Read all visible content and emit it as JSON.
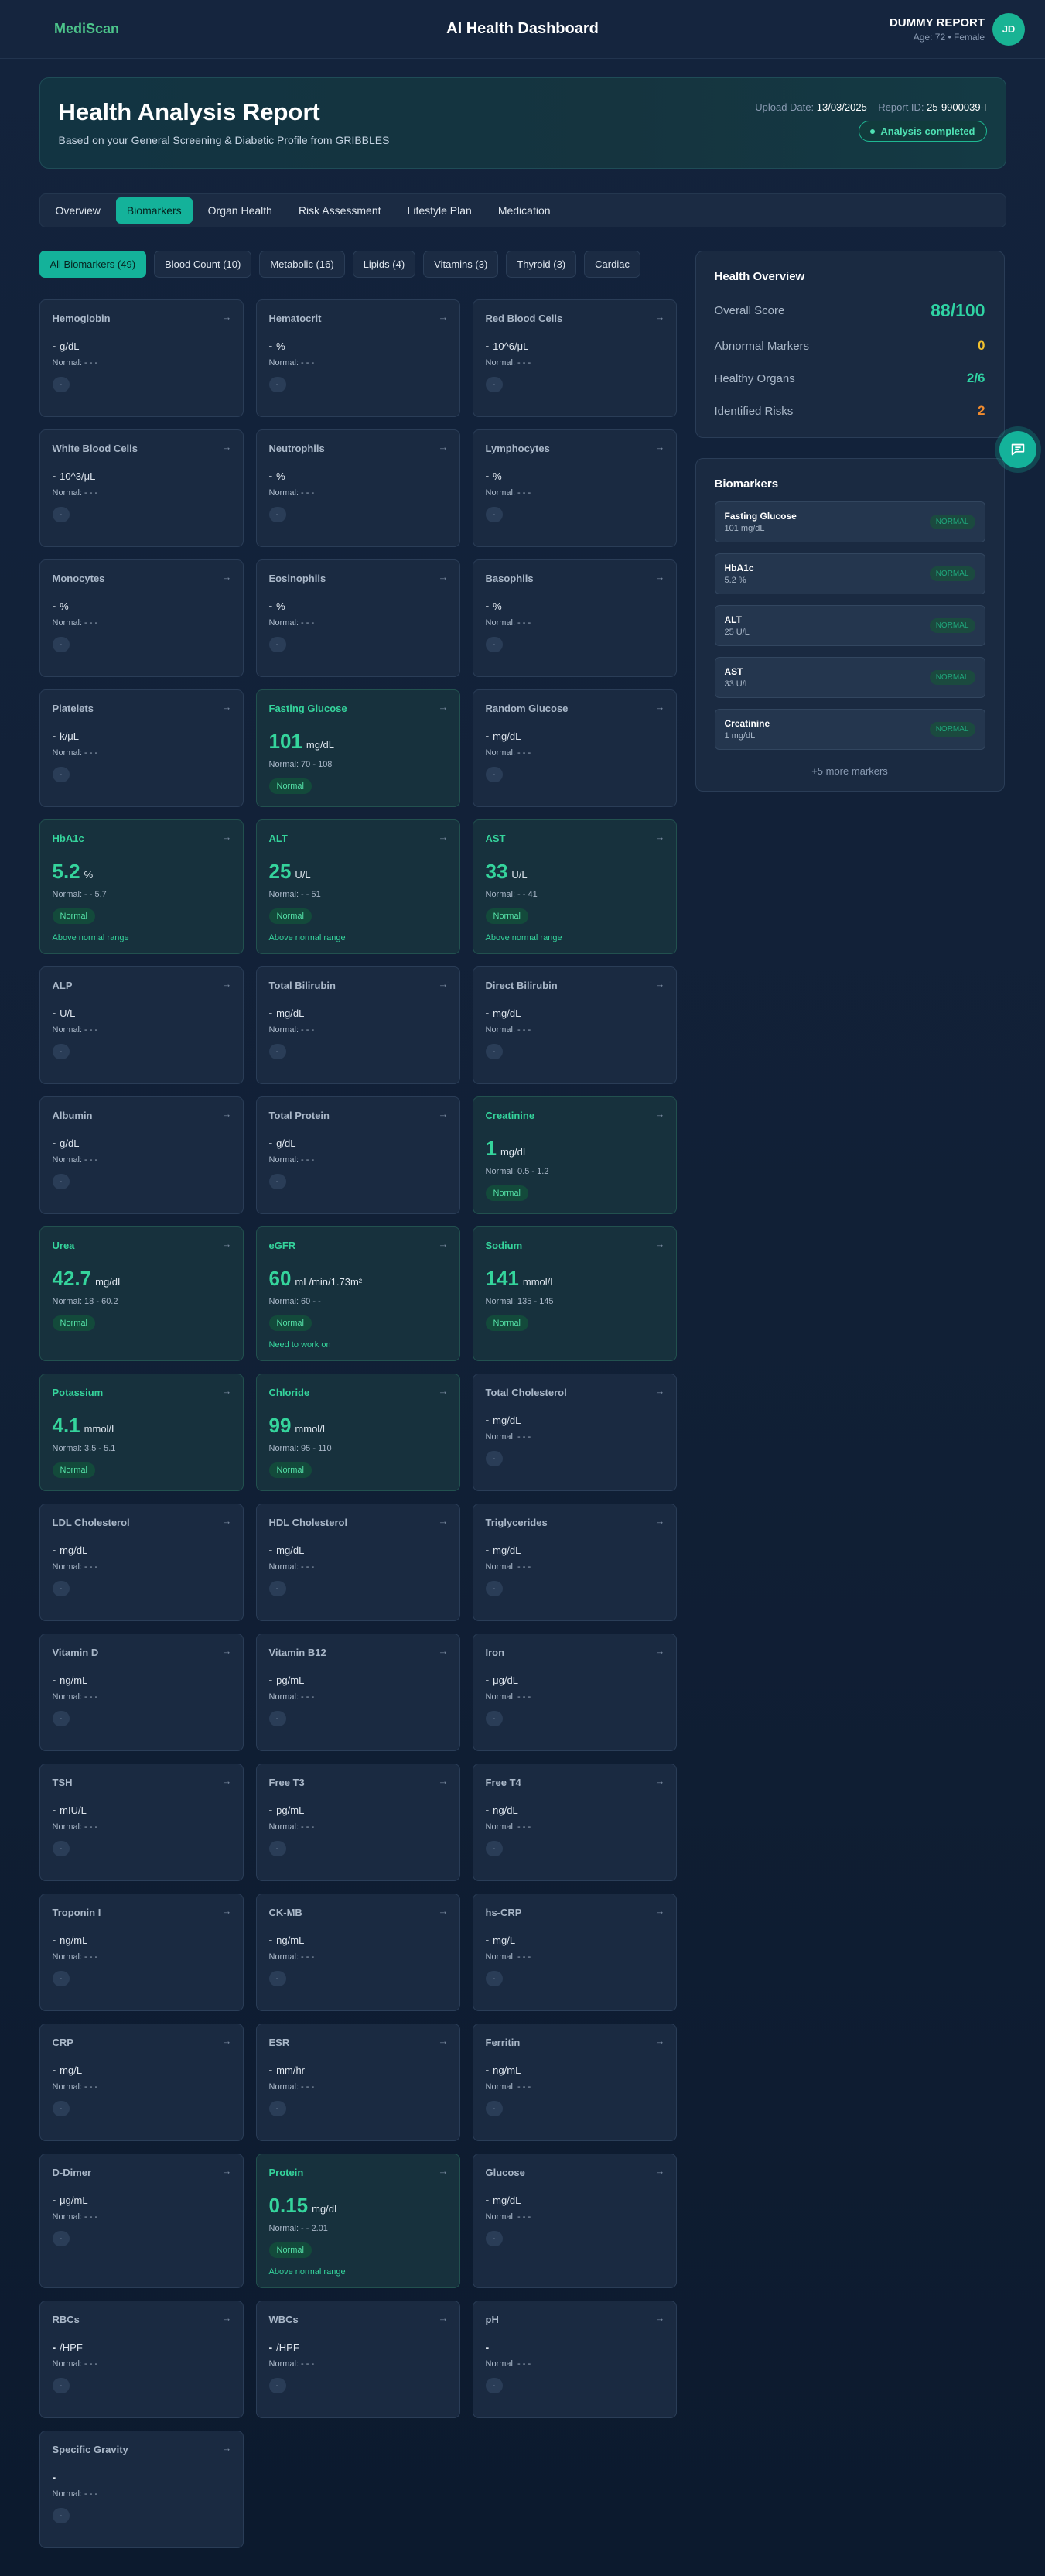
{
  "header": {
    "logo": "MediScan",
    "title": "AI Health Dashboard",
    "user_name": "DUMMY REPORT",
    "user_sub": "Age: 72 • Female",
    "avatar": "JD"
  },
  "hero": {
    "title": "Health Analysis Report",
    "subtitle": "Based on your General Screening & Diabetic Profile from GRIBBLES",
    "upload_label": "Upload Date:",
    "upload_value": "13/03/2025",
    "report_label": "Report ID:",
    "report_value": "25-9900039-I",
    "status": "Analysis completed"
  },
  "tabs": [
    "Overview",
    "Biomarkers",
    "Organ Health",
    "Risk Assessment",
    "Lifestyle Plan",
    "Medication"
  ],
  "filters": [
    "All Biomarkers (49)",
    "Blood Count (10)",
    "Metabolic (16)",
    "Lipids (4)",
    "Vitamins (3)",
    "Thyroid (3)",
    "Cardiac"
  ],
  "cards": [
    {
      "name": "Hemoglobin",
      "value": "-",
      "unit": "g/dL",
      "normal": "Normal: - - -"
    },
    {
      "name": "Hematocrit",
      "value": "-",
      "unit": "%",
      "normal": "Normal: - - -"
    },
    {
      "name": "Red Blood Cells",
      "value": "-",
      "unit": "10^6/μL",
      "normal": "Normal: - - -"
    },
    {
      "name": "White Blood Cells",
      "value": "-",
      "unit": "10^3/μL",
      "normal": "Normal: - - -"
    },
    {
      "name": "Neutrophils",
      "value": "-",
      "unit": "%",
      "normal": "Normal: - - -"
    },
    {
      "name": "Lymphocytes",
      "value": "-",
      "unit": "%",
      "normal": "Normal: - - -"
    },
    {
      "name": "Monocytes",
      "value": "-",
      "unit": "%",
      "normal": "Normal: - - -"
    },
    {
      "name": "Eosinophils",
      "value": "-",
      "unit": "%",
      "normal": "Normal: - - -"
    },
    {
      "name": "Basophils",
      "value": "-",
      "unit": "%",
      "normal": "Normal: - - -"
    },
    {
      "name": "Platelets",
      "value": "-",
      "unit": "k/μL",
      "normal": "Normal: - - -"
    },
    {
      "name": "Fasting Glucose",
      "value": "101",
      "unit": "mg/dL",
      "normal": "Normal: 70 - 108",
      "status": "Normal",
      "hl": true
    },
    {
      "name": "Random Glucose",
      "value": "-",
      "unit": "mg/dL",
      "normal": "Normal: - - -"
    },
    {
      "name": "HbA1c",
      "value": "5.2",
      "unit": "%",
      "normal": "Normal: - - 5.7",
      "status": "Normal",
      "note": "Above normal range",
      "hl": true
    },
    {
      "name": "ALT",
      "value": "25",
      "unit": "U/L",
      "normal": "Normal: - - 51",
      "status": "Normal",
      "note": "Above normal range",
      "hl": true
    },
    {
      "name": "AST",
      "value": "33",
      "unit": "U/L",
      "normal": "Normal: - - 41",
      "status": "Normal",
      "note": "Above normal range",
      "hl": true
    },
    {
      "name": "ALP",
      "value": "-",
      "unit": "U/L",
      "normal": "Normal: - - -"
    },
    {
      "name": "Total Bilirubin",
      "value": "-",
      "unit": "mg/dL",
      "normal": "Normal: - - -"
    },
    {
      "name": "Direct Bilirubin",
      "value": "-",
      "unit": "mg/dL",
      "normal": "Normal: - - -"
    },
    {
      "name": "Albumin",
      "value": "-",
      "unit": "g/dL",
      "normal": "Normal: - - -"
    },
    {
      "name": "Total Protein",
      "value": "-",
      "unit": "g/dL",
      "normal": "Normal: - - -"
    },
    {
      "name": "Creatinine",
      "value": "1",
      "unit": "mg/dL",
      "normal": "Normal: 0.5 - 1.2",
      "status": "Normal",
      "hl": true
    },
    {
      "name": "Urea",
      "value": "42.7",
      "unit": "mg/dL",
      "normal": "Normal: 18 - 60.2",
      "status": "Normal",
      "hl": true
    },
    {
      "name": "eGFR",
      "value": "60",
      "unit": "mL/min/1.73m²",
      "normal": "Normal: 60 - -",
      "status": "Normal",
      "note": "Need to work on",
      "hl": true
    },
    {
      "name": "Sodium",
      "value": "141",
      "unit": "mmol/L",
      "normal": "Normal: 135 - 145",
      "status": "Normal",
      "hl": true
    },
    {
      "name": "Potassium",
      "value": "4.1",
      "unit": "mmol/L",
      "normal": "Normal: 3.5 - 5.1",
      "status": "Normal",
      "hl": true
    },
    {
      "name": "Chloride",
      "value": "99",
      "unit": "mmol/L",
      "normal": "Normal: 95 - 110",
      "status": "Normal",
      "hl": true
    },
    {
      "name": "Total Cholesterol",
      "value": "-",
      "unit": "mg/dL",
      "normal": "Normal: - - -"
    },
    {
      "name": "LDL Cholesterol",
      "value": "-",
      "unit": "mg/dL",
      "normal": "Normal: - - -"
    },
    {
      "name": "HDL Cholesterol",
      "value": "-",
      "unit": "mg/dL",
      "normal": "Normal: - - -"
    },
    {
      "name": "Triglycerides",
      "value": "-",
      "unit": "mg/dL",
      "normal": "Normal: - - -"
    },
    {
      "name": "Vitamin D",
      "value": "-",
      "unit": "ng/mL",
      "normal": "Normal: - - -"
    },
    {
      "name": "Vitamin B12",
      "value": "-",
      "unit": "pg/mL",
      "normal": "Normal: - - -"
    },
    {
      "name": "Iron",
      "value": "-",
      "unit": "μg/dL",
      "normal": "Normal: - - -"
    },
    {
      "name": "TSH",
      "value": "-",
      "unit": "mIU/L",
      "normal": "Normal: - - -"
    },
    {
      "name": "Free T3",
      "value": "-",
      "unit": "pg/mL",
      "normal": "Normal: - - -"
    },
    {
      "name": "Free T4",
      "value": "-",
      "unit": "ng/dL",
      "normal": "Normal: - - -"
    },
    {
      "name": "Troponin I",
      "value": "-",
      "unit": "ng/mL",
      "normal": "Normal: - - -"
    },
    {
      "name": "CK-MB",
      "value": "-",
      "unit": "ng/mL",
      "normal": "Normal: - - -"
    },
    {
      "name": "hs-CRP",
      "value": "-",
      "unit": "mg/L",
      "normal": "Normal: - - -"
    },
    {
      "name": "CRP",
      "value": "-",
      "unit": "mg/L",
      "normal": "Normal: - - -"
    },
    {
      "name": "ESR",
      "value": "-",
      "unit": "mm/hr",
      "normal": "Normal: - - -"
    },
    {
      "name": "Ferritin",
      "value": "-",
      "unit": "ng/mL",
      "normal": "Normal: - - -"
    },
    {
      "name": "D-Dimer",
      "value": "-",
      "unit": "μg/mL",
      "normal": "Normal: - - -"
    },
    {
      "name": "Protein",
      "value": "0.15",
      "unit": "mg/dL",
      "normal": "Normal: - - 2.01",
      "status": "Normal",
      "note": "Above normal range",
      "hl": true
    },
    {
      "name": "Glucose",
      "value": "-",
      "unit": "mg/dL",
      "normal": "Normal: - - -"
    },
    {
      "name": "RBCs",
      "value": "-",
      "unit": "/HPF",
      "normal": "Normal: - - -"
    },
    {
      "name": "WBCs",
      "value": "-",
      "unit": "/HPF",
      "normal": "Normal: - - -"
    },
    {
      "name": "pH",
      "value": "-",
      "unit": "",
      "normal": "Normal: - - -"
    },
    {
      "name": "Specific Gravity",
      "value": "-",
      "unit": "",
      "normal": "Normal: - - -"
    }
  ],
  "overview": {
    "title": "Health Overview",
    "rows": [
      {
        "label": "Overall Score",
        "value": "88/100",
        "color": "#2fd3a3"
      },
      {
        "label": "Abnormal Markers",
        "value": "0",
        "color": "#f2c12e"
      },
      {
        "label": "Healthy Organs",
        "value": "2/6",
        "color": "#2fd3a3"
      },
      {
        "label": "Identified Risks",
        "value": "2",
        "color": "#f28c2e"
      }
    ]
  },
  "biomarkers_panel": {
    "title": "Biomarkers",
    "items": [
      {
        "name": "Fasting Glucose",
        "value": "101 mg/dL",
        "status": "NORMAL"
      },
      {
        "name": "HbA1c",
        "value": "5.2 %",
        "status": "NORMAL"
      },
      {
        "name": "ALT",
        "value": "25 U/L",
        "status": "NORMAL"
      },
      {
        "name": "AST",
        "value": "33 U/L",
        "status": "NORMAL"
      },
      {
        "name": "Creatinine",
        "value": "1 mg/dL",
        "status": "NORMAL"
      }
    ],
    "more": "+5 more markers"
  }
}
